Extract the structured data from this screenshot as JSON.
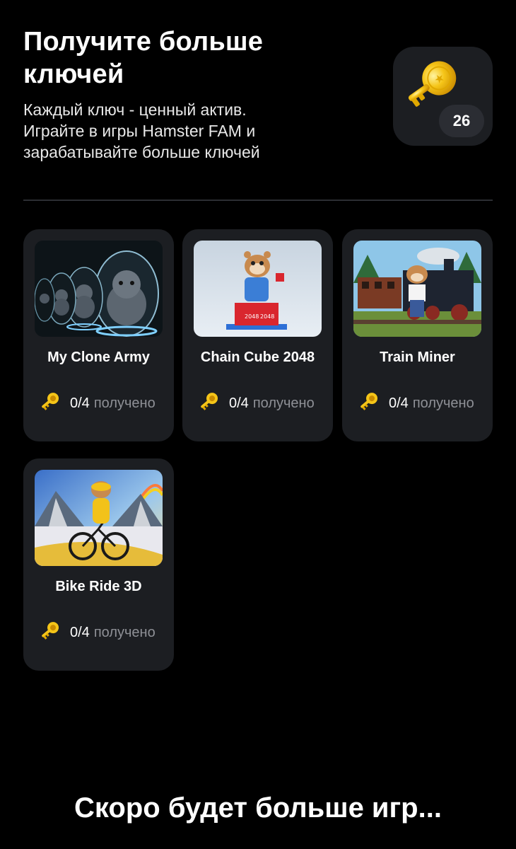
{
  "header": {
    "title_line1": "Получите больше",
    "title_line2": "ключей",
    "subtitle_line1": "Каждый ключ - ценный актив.",
    "subtitle_line2": "Играйте в игры Hamster FAM и",
    "subtitle_line3": "зарабатывайте больше ключей",
    "key_count": "26",
    "key_icon": "golden-key-icon"
  },
  "games": [
    {
      "name": "My Clone Army",
      "progress": "0/4",
      "progress_suffix": "получено",
      "image": "hamster-clones-image"
    },
    {
      "name": "Chain Cube 2048",
      "progress": "0/4",
      "progress_suffix": "получено",
      "image": "hamster-cube-image"
    },
    {
      "name": "Train Miner",
      "progress": "0/4",
      "progress_suffix": "получено",
      "image": "hamster-train-image"
    },
    {
      "name": "Bike Ride 3D",
      "progress": "0/4",
      "progress_suffix": "получено",
      "image": "hamster-bike-image"
    }
  ],
  "footer": {
    "text": "Скоро будет больше игр..."
  },
  "colors": {
    "background": "#000000",
    "card": "#1c1e22",
    "muted_text": "#8e9096",
    "key_gold": "#f5c518"
  }
}
